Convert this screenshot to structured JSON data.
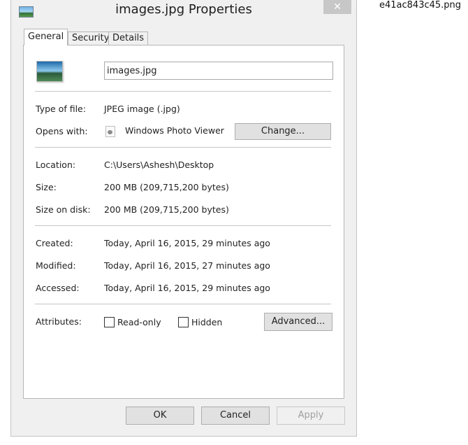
{
  "screenshot_filename": "e41ac843c45.png",
  "window": {
    "title": "images.jpg Properties",
    "close_symbol": "✕",
    "title_icon": "picture-file-icon"
  },
  "tabs": [
    {
      "label": "General",
      "active": true
    },
    {
      "label": "Security",
      "active": false
    },
    {
      "label": "Details",
      "active": false
    }
  ],
  "general": {
    "file_name": "images.jpg",
    "type_label": "Type of file:",
    "type_value": "JPEG image (.jpg)",
    "opens_label": "Opens with:",
    "opens_value": "Windows Photo Viewer",
    "change_button": "Change...",
    "location_label": "Location:",
    "location_value": "C:\\Users\\Ashesh\\Desktop",
    "size_label": "Size:",
    "size_value": "200 MB (209,715,200 bytes)",
    "size_on_disk_label": "Size on disk:",
    "size_on_disk_value": "200 MB (209,715,200 bytes)",
    "created_label": "Created:",
    "created_value": "Today, April 16, 2015, 29 minutes ago",
    "modified_label": "Modified:",
    "modified_value": "Today, April 16, 2015, 27 minutes ago",
    "accessed_label": "Accessed:",
    "accessed_value": "Today, April 16, 2015, 29 minutes ago",
    "attributes_label": "Attributes:",
    "readonly_label": "Read-only",
    "readonly_checked": false,
    "hidden_label": "Hidden",
    "hidden_checked": false,
    "advanced_button": "Advanced..."
  },
  "footer": {
    "ok": "OK",
    "cancel": "Cancel",
    "apply": "Apply",
    "apply_disabled": true
  },
  "colors": {
    "window_bg": "#f0f0f0",
    "panel_bg": "#ffffff",
    "close_button": "#c7c7c7",
    "separator": "#c6c6c6"
  }
}
